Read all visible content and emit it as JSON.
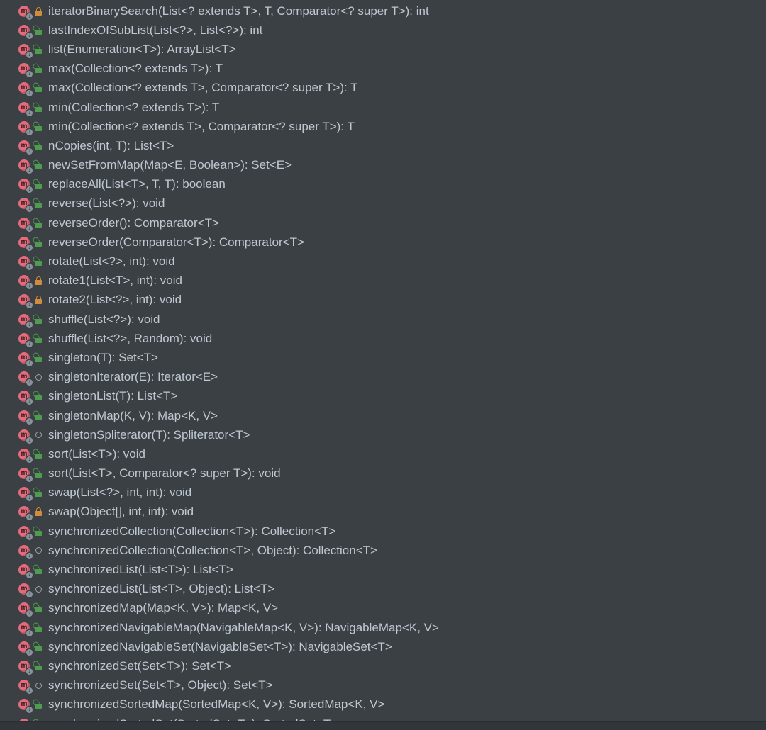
{
  "colors": {
    "bg": "#3b4045",
    "text": "#bfc7d0",
    "method": "#e46b7b",
    "lockPublic": "#4f9b4f",
    "lockPrivate": "#d08c3c",
    "package": "#9aa3ab"
  },
  "methods": [
    {
      "visibility": "private",
      "signature": "iteratorBinarySearch(List<? extends T>, T, Comparator<? super T>): int"
    },
    {
      "visibility": "public",
      "signature": "lastIndexOfSubList(List<?>, List<?>): int"
    },
    {
      "visibility": "public",
      "signature": "list(Enumeration<T>): ArrayList<T>"
    },
    {
      "visibility": "public",
      "signature": "max(Collection<? extends T>): T"
    },
    {
      "visibility": "public",
      "signature": "max(Collection<? extends T>, Comparator<? super T>): T"
    },
    {
      "visibility": "public",
      "signature": "min(Collection<? extends T>): T"
    },
    {
      "visibility": "public",
      "signature": "min(Collection<? extends T>, Comparator<? super T>): T"
    },
    {
      "visibility": "public",
      "signature": "nCopies(int, T): List<T>"
    },
    {
      "visibility": "public",
      "signature": "newSetFromMap(Map<E, Boolean>): Set<E>"
    },
    {
      "visibility": "public",
      "signature": "replaceAll(List<T>, T, T): boolean"
    },
    {
      "visibility": "public",
      "signature": "reverse(List<?>): void"
    },
    {
      "visibility": "public",
      "signature": "reverseOrder(): Comparator<T>"
    },
    {
      "visibility": "public",
      "signature": "reverseOrder(Comparator<T>): Comparator<T>"
    },
    {
      "visibility": "public",
      "signature": "rotate(List<?>, int): void"
    },
    {
      "visibility": "private",
      "signature": "rotate1(List<T>, int): void"
    },
    {
      "visibility": "private",
      "signature": "rotate2(List<?>, int): void"
    },
    {
      "visibility": "public",
      "signature": "shuffle(List<?>): void"
    },
    {
      "visibility": "public",
      "signature": "shuffle(List<?>, Random): void"
    },
    {
      "visibility": "public",
      "signature": "singleton(T): Set<T>"
    },
    {
      "visibility": "package",
      "signature": "singletonIterator(E): Iterator<E>"
    },
    {
      "visibility": "public",
      "signature": "singletonList(T): List<T>"
    },
    {
      "visibility": "public",
      "signature": "singletonMap(K, V): Map<K, V>"
    },
    {
      "visibility": "package",
      "signature": "singletonSpliterator(T): Spliterator<T>"
    },
    {
      "visibility": "public",
      "signature": "sort(List<T>): void"
    },
    {
      "visibility": "public",
      "signature": "sort(List<T>, Comparator<? super T>): void"
    },
    {
      "visibility": "public",
      "signature": "swap(List<?>, int, int): void"
    },
    {
      "visibility": "private",
      "signature": "swap(Object[], int, int): void"
    },
    {
      "visibility": "public",
      "signature": "synchronizedCollection(Collection<T>): Collection<T>"
    },
    {
      "visibility": "package",
      "signature": "synchronizedCollection(Collection<T>, Object): Collection<T>"
    },
    {
      "visibility": "public",
      "signature": "synchronizedList(List<T>): List<T>"
    },
    {
      "visibility": "package",
      "signature": "synchronizedList(List<T>, Object): List<T>"
    },
    {
      "visibility": "public",
      "signature": "synchronizedMap(Map<K, V>): Map<K, V>"
    },
    {
      "visibility": "public",
      "signature": "synchronizedNavigableMap(NavigableMap<K, V>): NavigableMap<K, V>"
    },
    {
      "visibility": "public",
      "signature": "synchronizedNavigableSet(NavigableSet<T>): NavigableSet<T>"
    },
    {
      "visibility": "public",
      "signature": "synchronizedSet(Set<T>): Set<T>"
    },
    {
      "visibility": "package",
      "signature": "synchronizedSet(Set<T>, Object): Set<T>"
    },
    {
      "visibility": "public",
      "signature": "synchronizedSortedMap(SortedMap<K, V>): SortedMap<K, V>"
    },
    {
      "visibility": "public",
      "signature": "synchronizedSortedSet(SortedSet<T>): SortedSet<T>"
    }
  ]
}
